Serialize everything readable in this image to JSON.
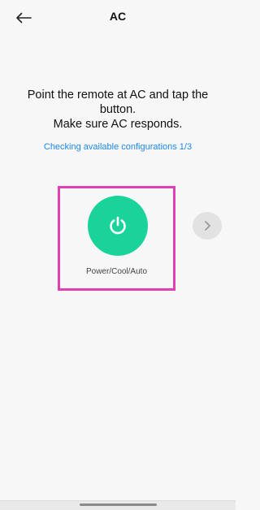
{
  "header": {
    "title": "AC",
    "back_icon": "back-arrow-icon"
  },
  "instructions": {
    "line1": "Point the remote at AC and tap the button.",
    "line2": "Make sure AC responds."
  },
  "status": {
    "text": "Checking available configurations 1/3"
  },
  "remote_button": {
    "label": "Power/Cool/Auto",
    "icon": "power-icon",
    "color": "#1ad39a"
  },
  "next_button": {
    "icon": "chevron-right-icon"
  },
  "colors": {
    "background": "#f7f7f7",
    "accent_blue": "#1e88e5",
    "highlight_pink": "#e040b0",
    "power_green": "#1ad39a"
  }
}
